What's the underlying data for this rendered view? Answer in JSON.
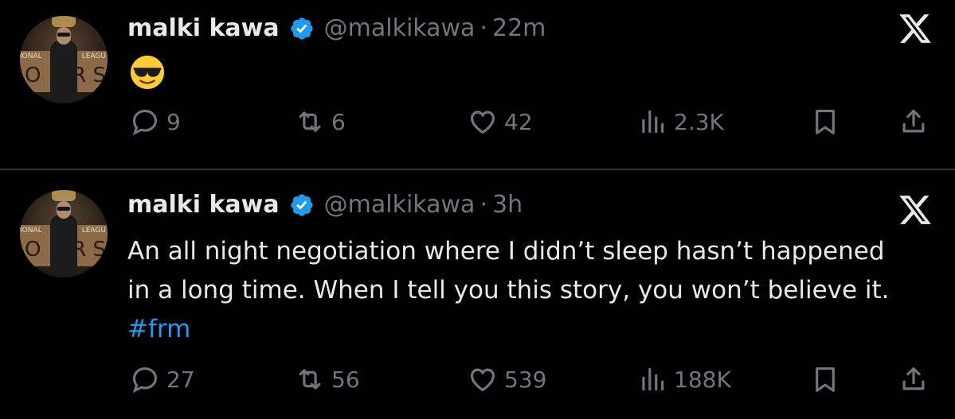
{
  "tweets": [
    {
      "name": "malki kawa",
      "handle": "@malkikawa",
      "separator": "·",
      "time": "22m",
      "emoji": "smiling-face-with-sunglasses",
      "text": "",
      "hashtag": "",
      "replies": "9",
      "reposts": "6",
      "likes": "42",
      "views": "2.3K",
      "avatar_text_left": "IONAL",
      "avatar_text_right": "LEAGU",
      "avatar_big_left": "O",
      "avatar_big_right": "R S"
    },
    {
      "name": "malki kawa",
      "handle": "@malkikawa",
      "separator": "·",
      "time": "3h",
      "text": "An all night negotiation where I didn’t sleep hasn’t happened in a long time. When I tell you this story, you won’t believe it.",
      "hashtag": "#frm",
      "replies": "27",
      "reposts": "56",
      "likes": "539",
      "views": "188K",
      "avatar_text_left": "IONAL",
      "avatar_text_right": "LEAGU",
      "avatar_big_left": "O",
      "avatar_big_right": "R S"
    }
  ],
  "colors": {
    "background": "#000000",
    "text": "#e7e9ea",
    "muted": "#71767b",
    "link": "#1d9bf0",
    "verified": "#1d9bf0",
    "divider": "#2f3336"
  }
}
